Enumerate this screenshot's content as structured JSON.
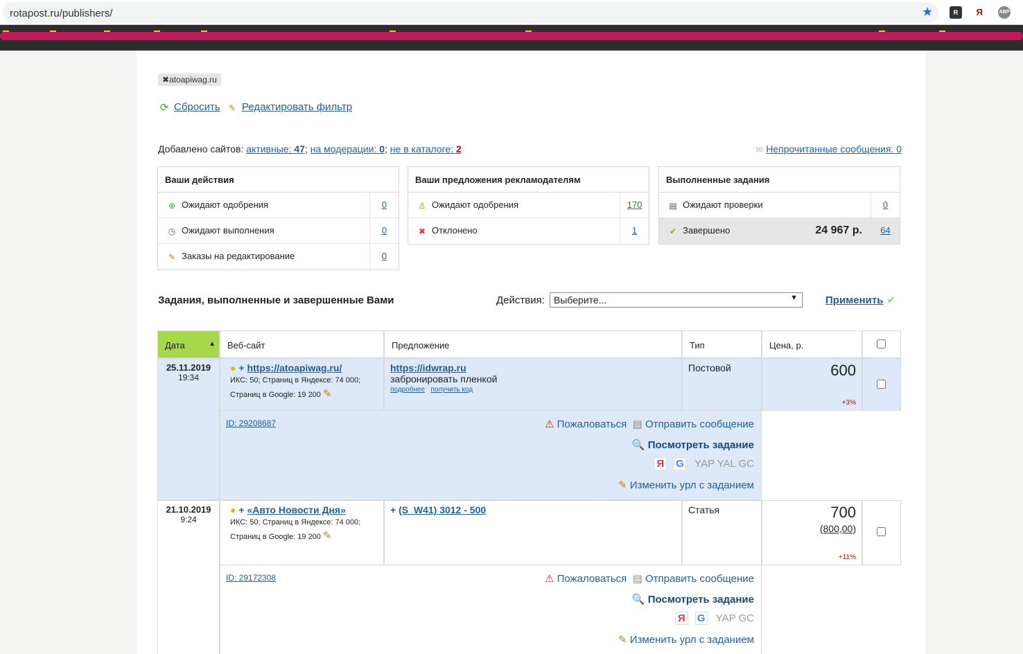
{
  "browser": {
    "url": "rotapost.ru/publishers/",
    "ext_labels": [
      "R",
      "Я",
      "ABP"
    ]
  },
  "filter": {
    "tag": "atoapiwag.ru",
    "reset": "Сбросить",
    "edit": "Редактировать фильтр"
  },
  "sites": {
    "prefix": "Добавлено сайтов:",
    "active_label": "активные:",
    "active": "47",
    "sep1": ";",
    "moderation_label": "на модерации:",
    "moderation": "0",
    "sep2": ";",
    "not_catalog_label": "не в каталоге:",
    "not_catalog": "2",
    "unread": "Непрочитанные сообщения: 0"
  },
  "panels": [
    {
      "title": "Ваши действия",
      "rows": [
        {
          "label": "Ожидают одобрения",
          "value": "0"
        },
        {
          "label": "Ожидают выполнения",
          "value": "0"
        },
        {
          "label": "Заказы на редактирование",
          "value": "0"
        }
      ]
    },
    {
      "title": "Ваши предложения рекламодателям",
      "rows": [
        {
          "label": "Ожидают одобрения",
          "value": "170"
        },
        {
          "label": "Отклонено",
          "value": "1"
        }
      ]
    },
    {
      "title": "Выполненные задания",
      "rows": [
        {
          "label": "Ожидают проверки",
          "value": "0"
        },
        {
          "label": "Завершено",
          "amount": "24 967 р.",
          "value": "64"
        }
      ]
    }
  ],
  "tasks": {
    "title": "Задания, выполненные и завершенные Вами",
    "actions_label": "Действия:",
    "select": "Выберите...",
    "apply": "Применить"
  },
  "headers": [
    "Дата",
    "Веб-сайт",
    "Предложение",
    "Тип",
    "Цена, р."
  ],
  "rows": [
    {
      "date": "25.11.2019",
      "time": "19:34",
      "site": "https://atoapiwag.ru/",
      "iks": "ИКС: 50; Страниц в Яндексе: 74 000;",
      "google": "Страниц в Google: 19 200",
      "offer_link": "https://idwrap.ru",
      "offer_text": "забронировать пленкой",
      "more": "подробнее",
      "code": "получить код",
      "type": "Постовой",
      "price": "600",
      "old_price": "",
      "pct": "+3%",
      "id": "ID: 29208687",
      "complain": "Пожаловаться",
      "message": "Отправить сообщение",
      "view": "Посмотреть задание",
      "engines": "YAP YAL GC",
      "change": "Изменить урл с заданием"
    },
    {
      "date": "21.10.2019",
      "time": "9:24",
      "site": "«Авто Новости Дня»",
      "iks": "ИКС: 50; Страниц в Яндексе: 74 000;",
      "google": "Страниц в Google: 19 200",
      "offer_link": "(S_W41) 3012 - 500",
      "offer_text": "",
      "more": "",
      "code": "",
      "type": "Статья",
      "price": "700",
      "old_price": "(800,00)",
      "pct": "+11%",
      "id": "ID: 29172308",
      "complain": "Пожаловаться",
      "message": "Отправить сообщение",
      "view": "Посмотреть задание",
      "engines": "YAP GC",
      "change": "Изменить урл с заданием"
    }
  ]
}
